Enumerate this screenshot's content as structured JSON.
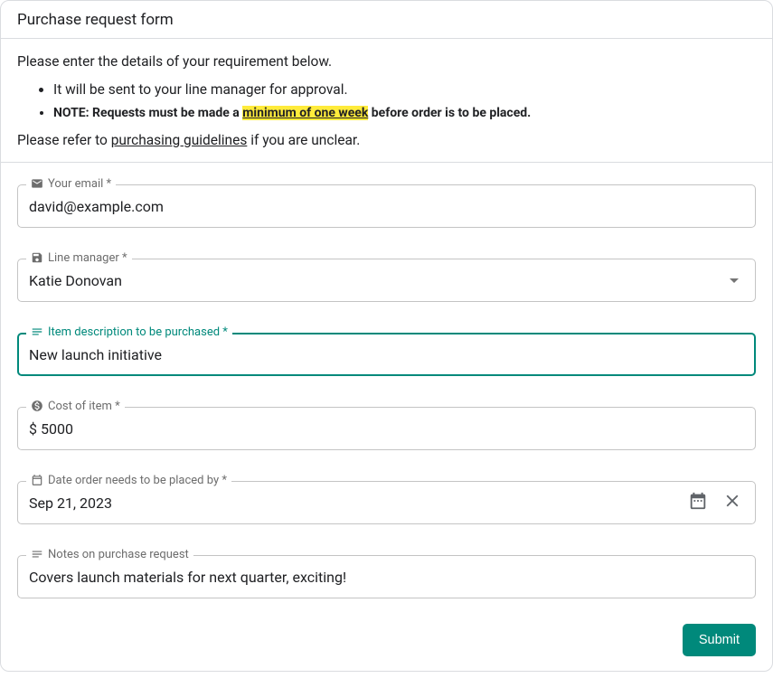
{
  "header": {
    "title": "Purchase request form"
  },
  "intro": {
    "line1": "Please enter the details of your requirement below.",
    "bullet1": "It will be sent to your line manager for approval.",
    "note_prefix": "NOTE: Requests must be made a ",
    "note_highlight": "minimum of one week",
    "note_suffix": " before order is to be placed.",
    "refer_prefix": "Please refer to ",
    "refer_link": "purchasing guidelines",
    "refer_suffix": " if you are unclear."
  },
  "fields": {
    "email": {
      "label": "Your email *",
      "value": "david@example.com"
    },
    "manager": {
      "label": "Line manager *",
      "value": "Katie Donovan"
    },
    "description": {
      "label": "Item description to be purchased *",
      "value": "New launch initiative"
    },
    "cost": {
      "label": "Cost of item *",
      "value": "$ 5000"
    },
    "date": {
      "label": "Date order needs to be placed by *",
      "value": "Sep 21, 2023"
    },
    "notes": {
      "label": "Notes on purchase request",
      "value": "Covers launch materials for next quarter, exciting!"
    }
  },
  "actions": {
    "submit_label": "Submit"
  }
}
